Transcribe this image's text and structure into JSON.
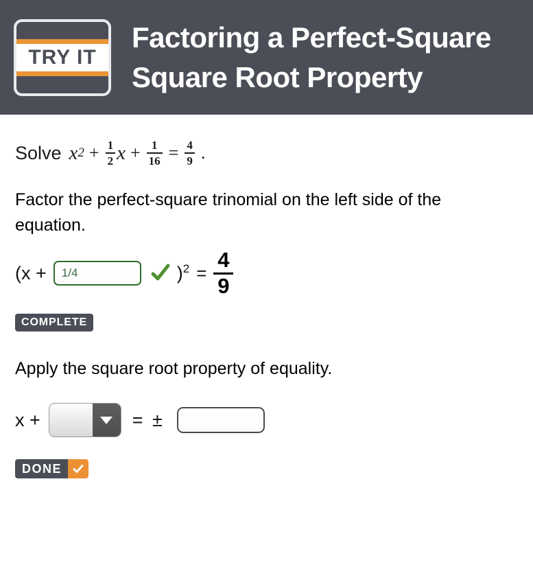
{
  "header": {
    "logo": {
      "text": "TRY IT",
      "stripe_color": "#ea9436",
      "bg_color": "#4b4e57"
    },
    "title_line1": "Factoring a Perfect-Square",
    "title_line2": "Square Root Property",
    "bg_color": "#4b4e57"
  },
  "problem": {
    "solve_word": "Solve",
    "variable": "x",
    "exponent": "2",
    "plus1": "+",
    "frac1": {
      "num": "1",
      "den": "2"
    },
    "coef_var": "x",
    "plus2": "+",
    "frac2": {
      "num": "1",
      "den": "16"
    },
    "equals": "=",
    "frac3": {
      "num": "4",
      "den": "9"
    },
    "period": "."
  },
  "step1": {
    "instruction": "Factor the perfect-square trinomial on the left side of the equation.",
    "open_paren": "(x +",
    "input_value": "1/4",
    "input_placeholder": "",
    "check_icon": "green-check-icon",
    "check_color": "#4f8f2f",
    "close_paren": ")",
    "square_exponent": "2",
    "equals": "=",
    "result_frac": {
      "num": "4",
      "den": "9"
    },
    "badge_label": "COMPLETE"
  },
  "step2": {
    "instruction": "Apply the square root property of equality.",
    "lhs": "x +",
    "dropdown_value": "",
    "dropdown_icon": "chevron-down-icon",
    "equals_plusminus": "= ±",
    "answer_value": "",
    "answer_placeholder": "",
    "done_label": "DONE",
    "done_check_icon": "white-check-icon",
    "done_accent_color": "#ec9133"
  }
}
